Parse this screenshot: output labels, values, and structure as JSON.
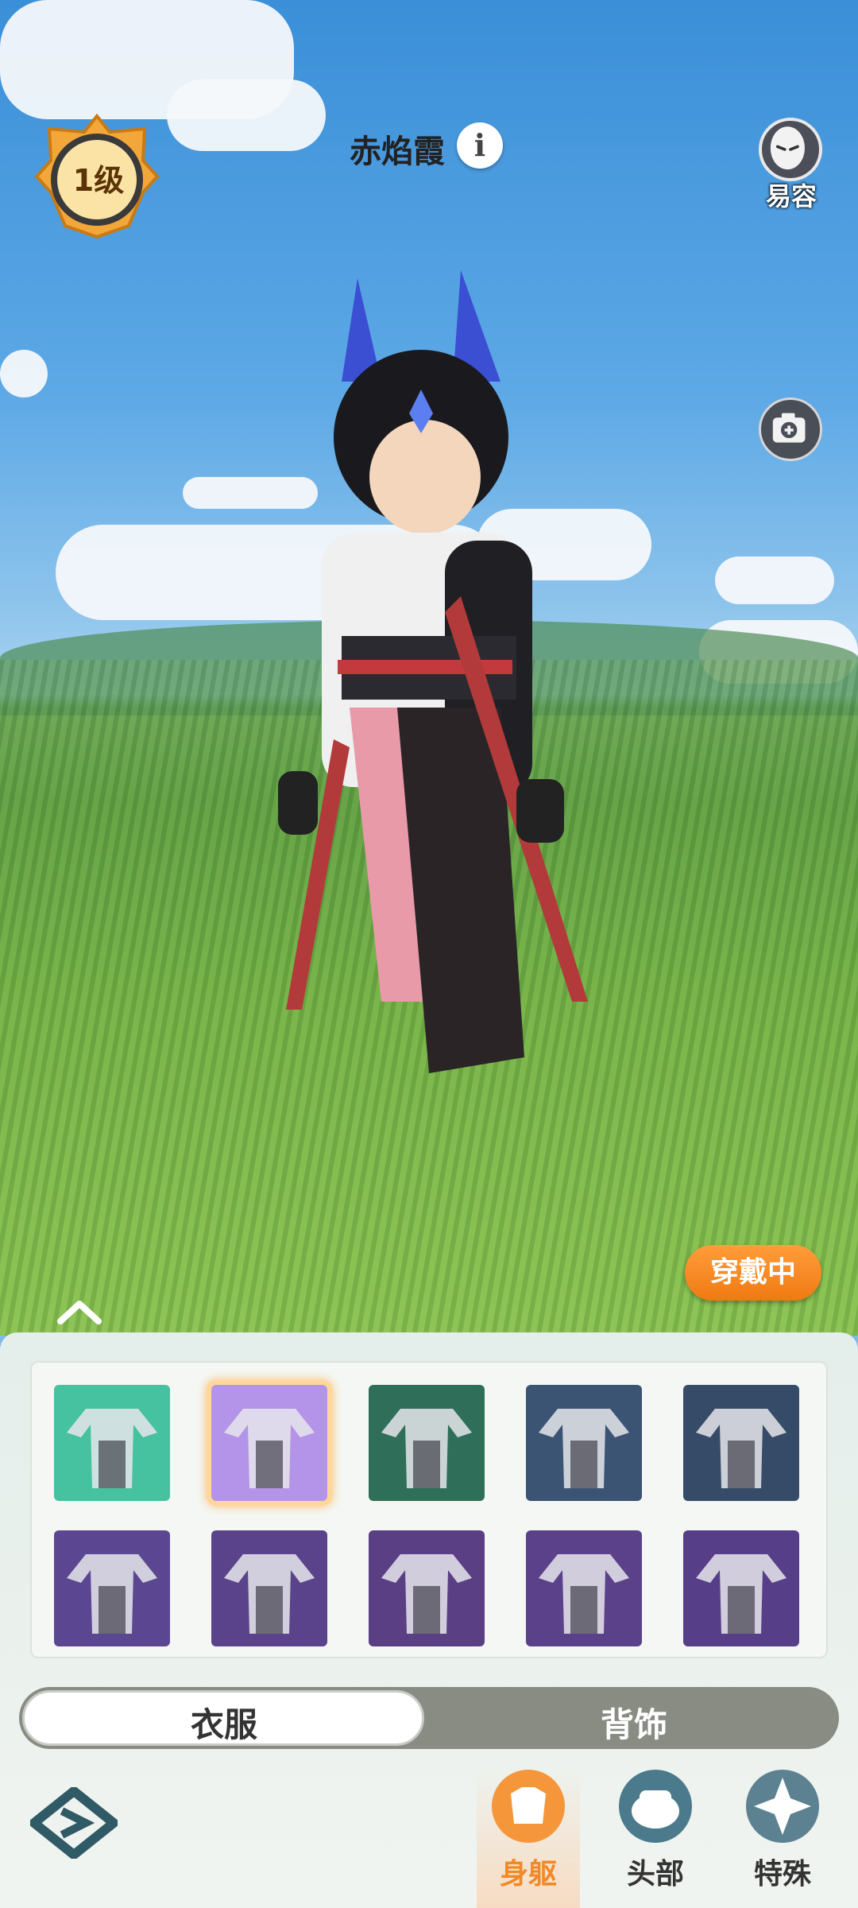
{
  "header": {
    "level": "1级",
    "character_name": "赤焰霞",
    "info_icon": "i",
    "disguise_label": "易容"
  },
  "status": {
    "equipped_label": "穿戴中"
  },
  "outfits": {
    "items": [
      {
        "icon": "outfit-teal-white",
        "bg": "#46c2a0"
      },
      {
        "icon": "outfit-pink-black",
        "bg": "#b494e8",
        "selected": true
      },
      {
        "icon": "outfit-white-gold",
        "bg": "#2f6e58"
      },
      {
        "icon": "outfit-red-black",
        "bg": "#3b5473"
      },
      {
        "icon": "outfit-blue-gray",
        "bg": "#354b68"
      },
      {
        "icon": "outfit-gray-blue",
        "bg": "#5b4691"
      },
      {
        "icon": "outfit-gray-navy",
        "bg": "#5a438b"
      },
      {
        "icon": "outfit-orange-dark",
        "bg": "#5a3f85"
      },
      {
        "icon": "outfit-yellow-white",
        "bg": "#5b418a"
      },
      {
        "icon": "outfit-teal-gold",
        "bg": "#563f88"
      }
    ]
  },
  "tabs": {
    "clothes": "衣服",
    "back_accessory": "背饰"
  },
  "bottom_nav": {
    "body": "身躯",
    "head": "头部",
    "special": "特殊"
  },
  "colors": {
    "accent": "#f07a12",
    "nav_active": "#f08a28",
    "nav_inactive": "#333333"
  }
}
